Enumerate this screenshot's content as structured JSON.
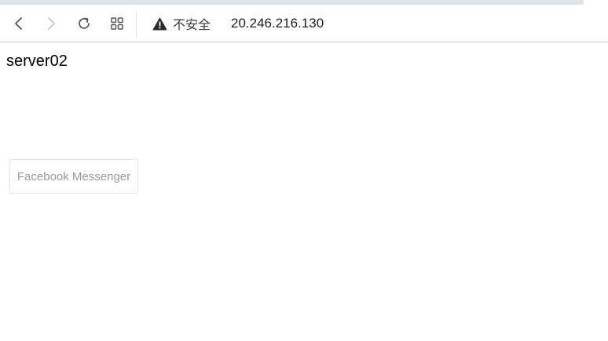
{
  "browser": {
    "security_label": "不安全",
    "address": "20.246.216.130",
    "icons": {
      "back": "back-icon",
      "forward": "forward-icon",
      "reload": "reload-icon",
      "apps": "apps-icon",
      "warning": "warning-icon"
    }
  },
  "page": {
    "server_name": "server02",
    "facebook_button_label": "Facebook Messenger"
  }
}
